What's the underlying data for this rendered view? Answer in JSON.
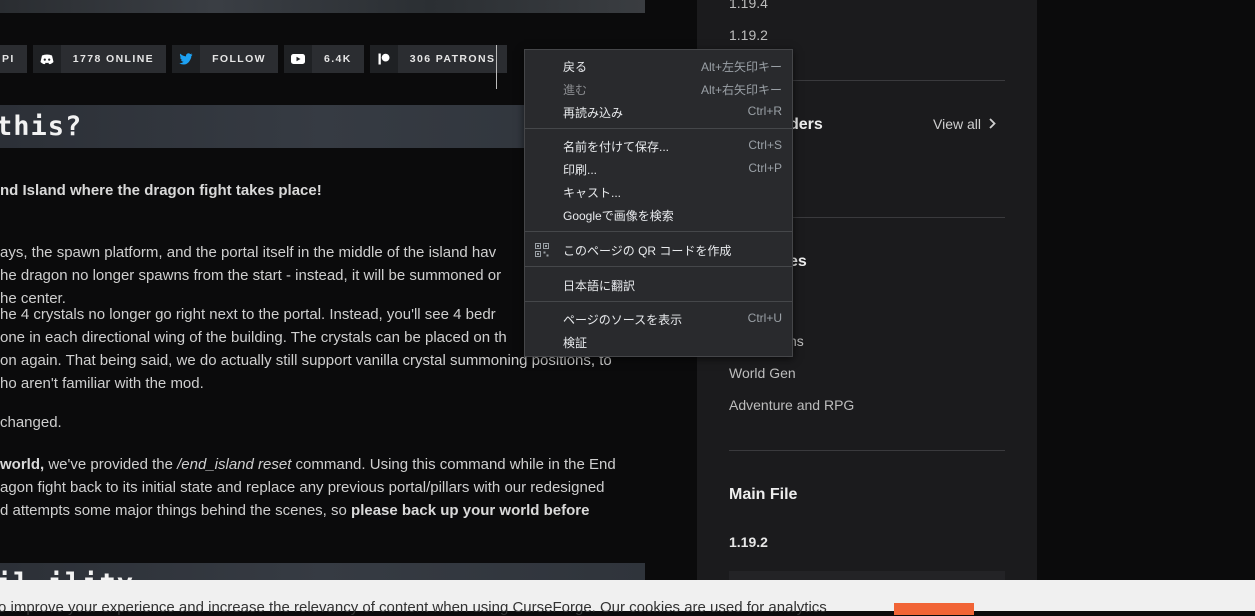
{
  "social_bar": {
    "api_label": "PI",
    "discord_label": "1778 ONLINE",
    "twitter_label": "FOLLOW",
    "youtube_label": "6.4K",
    "patreon_label": "306 PATRONS"
  },
  "article": {
    "section1_title": "this?",
    "section2_title": "il-ility",
    "p1": "nd Island where the dragon fight takes place!",
    "p2_l1": "ays, the spawn platform, and the portal itself in the middle of the island hav",
    "p2_l2": "he dragon no longer spawns from the start - instead, it will be summoned or",
    "p2_l3": "he center.",
    "p3_l1": "he 4 crystals no longer go right next to the portal. Instead, you'll see 4 bedr",
    "p3_l2": "one in each directional wing of the building. The crystals can be placed on th",
    "p3_l3": "on again. That being said, we do actually still support vanilla crystal summoning positions, to",
    "p3_l4": "ho aren't familiar with the mod.",
    "p4": "changed.",
    "p5_l1_bold": "world,",
    "p5_l1_a": " we've provided the ",
    "p5_l1_cmd": "/end_island reset",
    "p5_l1_b": " command. Using this command while in the End",
    "p5_l2": "agon fight back to its initial state and replace any previous portal/pillars with our redesigned",
    "p5_l3_a": "d attempts some major things behind the scenes, so ",
    "p5_l3_bold": "please back up your world before"
  },
  "sidebar": {
    "version_top": "1.19.4",
    "version_2": "1.19.2",
    "loaders_heading": "ders",
    "view_all": "View all",
    "categories_heading": "es",
    "cat_partial": "ns",
    "cat_world_gen": "World Gen",
    "cat_adventure": "Adventure and RPG",
    "main_file_heading": "Main File",
    "main_file_version": "1.19.2"
  },
  "cookie": {
    "text": "o improve your experience and increase the relevancy of content when using CurseForge. Our cookies are used for analytics"
  },
  "context_menu": {
    "back": "戻る",
    "back_sc": "Alt+左矢印キー",
    "forward": "進む",
    "forward_sc": "Alt+右矢印キー",
    "reload": "再読み込み",
    "reload_sc": "Ctrl+R",
    "save_as": "名前を付けて保存...",
    "save_as_sc": "Ctrl+S",
    "print": "印刷...",
    "print_sc": "Ctrl+P",
    "cast": "キャスト...",
    "search_image": "Googleで画像を検索",
    "qr": "このページの QR コードを作成",
    "translate": "日本語に翻訳",
    "view_source": "ページのソースを表示",
    "view_source_sc": "Ctrl+U",
    "inspect": "検証"
  }
}
